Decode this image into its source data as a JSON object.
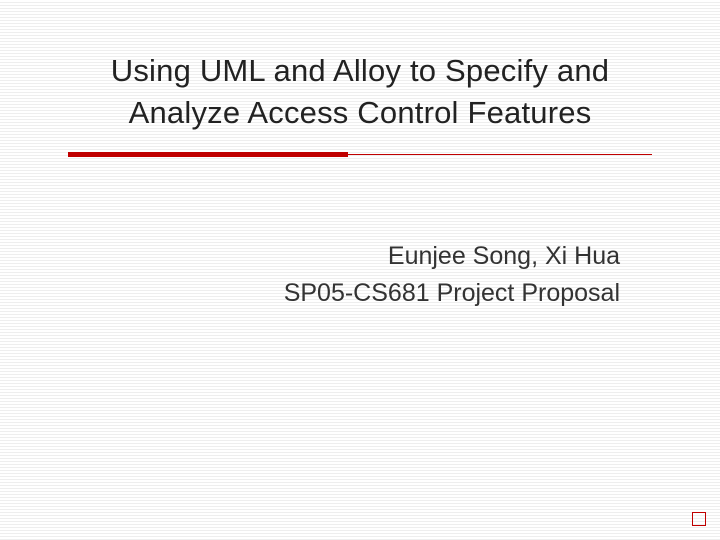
{
  "slide": {
    "title": "Using UML and Alloy to Specify and Analyze Access Control Features",
    "authors": "Eunjee Song, Xi Hua",
    "subtitle": "SP05-CS681 Project Proposal",
    "accent_color": "#c00000"
  }
}
